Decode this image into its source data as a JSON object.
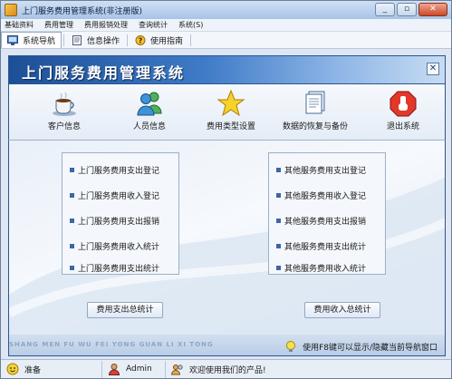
{
  "window": {
    "title": "上门服务费用管理系统(非注册版)",
    "controls": [
      "_",
      "▫",
      "✕"
    ]
  },
  "menu": [
    "基础资料",
    "费用管理",
    "费用报销处理",
    "查询统计",
    "系统(S)"
  ],
  "toolbar": [
    {
      "label": "系统导航",
      "icon": "monitor-icon"
    },
    {
      "label": "信息操作",
      "icon": "document-icon"
    },
    {
      "label": "使用指南",
      "icon": "help-icon"
    }
  ],
  "banner": {
    "title": "上门服务费用管理系统",
    "close": "✕"
  },
  "iconbar": [
    {
      "label": "客户信息",
      "icon": "coffee-cup-icon"
    },
    {
      "label": "人员信息",
      "icon": "users-icon"
    },
    {
      "label": "费用类型设置",
      "icon": "star-icon"
    },
    {
      "label": "数据的恢复与备份",
      "icon": "documents-icon"
    },
    {
      "label": "退出系统",
      "icon": "stop-icon"
    }
  ],
  "left_panel": {
    "items": [
      "上门服务费用支出登记",
      "上门服务费用收入登记",
      "上门服务费用支出报销",
      "上门服务费用收入统计",
      "上门服务费用支出统计"
    ],
    "button": "费用支出总统计"
  },
  "right_panel": {
    "items": [
      "其他服务费用支出登记",
      "其他服务费用收入登记",
      "其他服务费用支出报销",
      "其他服务费用支出统计",
      "其他服务费用收入统计"
    ],
    "button": "费用收入总统计"
  },
  "footer": {
    "pinyin": "SHANG MEN FU WU FEI YONG GUAN LI XI TONG",
    "hint": "使用F8键可以显示/隐藏当前导航窗口"
  },
  "statusbar": {
    "ready": "准备",
    "user": "Admin",
    "welcome": "欢迎使用我们的产品!"
  },
  "colors": {
    "accent": "#1d4f96",
    "panel_border": "#9db0c9",
    "bullet": "#3e67a3"
  }
}
